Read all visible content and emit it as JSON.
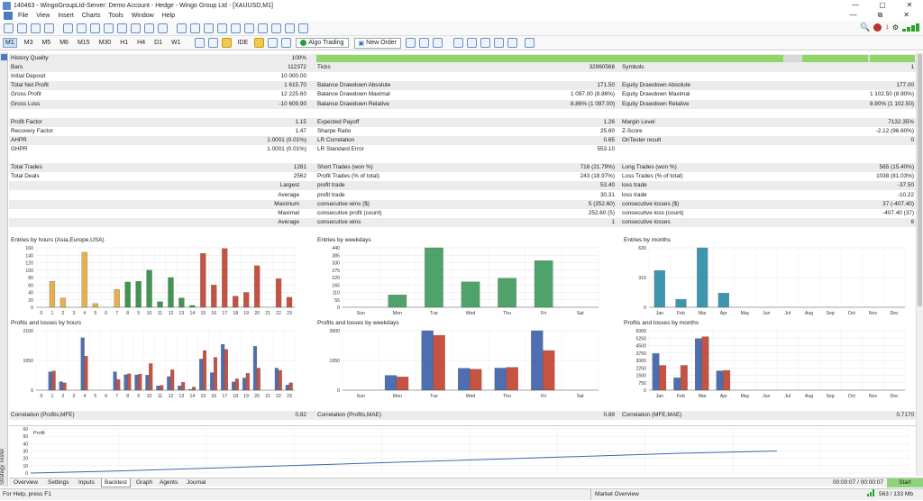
{
  "window": {
    "title": "140463 - WingoGroupLtd-Server: Demo Account - Hedge - Wingo Group Ltd - [XAUUSD,M1]",
    "controls": [
      "—",
      "▢",
      "✕"
    ]
  },
  "menu": {
    "items": [
      "File",
      "View",
      "Insert",
      "Charts",
      "Tools",
      "Window",
      "Help"
    ],
    "right": [
      "—",
      "⧉",
      "✕"
    ]
  },
  "toolbar": {
    "timeframes": [
      "M1",
      "M3",
      "M5",
      "M6",
      "M15",
      "M30",
      "H1",
      "H4",
      "D1",
      "W1"
    ],
    "ide": "IDE",
    "algo_trading": "Algo Trading",
    "new_order": "New Order",
    "signal_count": "1"
  },
  "sidebar": {
    "label": "Strategy Tester"
  },
  "stats": {
    "history_quality_label": "History Quality",
    "history_quality": "100%",
    "history_bar": [
      {
        "start": 0.0,
        "end": 0.78
      },
      {
        "start": 0.812,
        "end": 0.922
      },
      {
        "start": 0.924,
        "end": 1.0
      }
    ],
    "rows": [
      {
        "y": 0,
        "shade": true,
        "c": [
          [
            "Bars",
            "112372"
          ],
          [
            "Ticks",
            "32960568"
          ],
          [
            "Symbols",
            "1"
          ]
        ]
      },
      {
        "y": 1,
        "shade": false,
        "c": [
          [
            "Initial Deposit",
            "10 000.00"
          ],
          [
            "",
            ""
          ],
          [
            "",
            ""
          ]
        ]
      },
      {
        "y": 2,
        "shade": true,
        "c": [
          [
            "Total Net Profit",
            "1 615.70"
          ],
          [
            "Balance Drawdown Absolute",
            "171.50"
          ],
          [
            "Equity Drawdown Absolute",
            "177.00"
          ]
        ]
      },
      {
        "y": 3,
        "shade": false,
        "c": [
          [
            "Gross Profit",
            "12 225.60"
          ],
          [
            "Balance Drawdown Maximal",
            "1 097.00 (8.86%)"
          ],
          [
            "Equity Drawdown Maximal",
            "1 102.50 (8.90%)"
          ]
        ]
      },
      {
        "y": 4,
        "shade": true,
        "c": [
          [
            "Gross Loss",
            "-10 609.90"
          ],
          [
            "Balance Drawdown Relative",
            "8.86% (1 097.00)"
          ],
          [
            "Equity Drawdown Relative",
            "8.90% (1 102.50)"
          ]
        ]
      },
      {
        "y": 6,
        "shade": true,
        "c": [
          [
            "Profit Factor",
            "1.15"
          ],
          [
            "Expected Payoff",
            "1.26"
          ],
          [
            "Margin Level",
            "7132.35%"
          ]
        ]
      },
      {
        "y": 7,
        "shade": false,
        "c": [
          [
            "Recovery Factor",
            "1.47"
          ],
          [
            "Sharpe Ratio",
            "25.60"
          ],
          [
            "Z-Score",
            "-2.12 (96.60%)"
          ]
        ]
      },
      {
        "y": 8,
        "shade": true,
        "c": [
          [
            "AHPR",
            "1.0001 (0.01%)"
          ],
          [
            "LR Correlation",
            "0.65"
          ],
          [
            "OnTester result",
            "0"
          ]
        ]
      },
      {
        "y": 9,
        "shade": false,
        "c": [
          [
            "GHPR",
            "1.0001 (0.01%)"
          ],
          [
            "LR Standard Error",
            "553.10"
          ],
          [
            "",
            ""
          ]
        ]
      },
      {
        "y": 11,
        "shade": true,
        "c": [
          [
            "Total Trades",
            "1281"
          ],
          [
            "Short Trades (won %)",
            "716 (21.79%)"
          ],
          [
            "Long Trades (won %)",
            "565 (15.40%)"
          ]
        ]
      },
      {
        "y": 12,
        "shade": false,
        "c": [
          [
            "Total Deals",
            "2562"
          ],
          [
            "Profit Trades (% of total)",
            "243 (18.97%)"
          ],
          [
            "Loss Trades (% of total)",
            "1038 (81.03%)"
          ]
        ]
      }
    ],
    "sub_rows": [
      {
        "y": 13,
        "shade": true,
        "label": "Largest",
        "c": [
          [
            "profit trade",
            "53.40"
          ],
          [
            "loss trade",
            "-37.50"
          ]
        ]
      },
      {
        "y": 14,
        "shade": false,
        "label": "Average",
        "c": [
          [
            "profit trade",
            "30.31"
          ],
          [
            "loss trade",
            "-10.22"
          ]
        ]
      },
      {
        "y": 15,
        "shade": true,
        "label": "Maximum",
        "c": [
          [
            "consecutive wins ($)",
            "5 (252.60)"
          ],
          [
            "consecutive losses ($)",
            "37 (-407.40)"
          ]
        ]
      },
      {
        "y": 16,
        "shade": false,
        "label": "Maximal",
        "c": [
          [
            "consecutive profit (count)",
            "252.60 (5)"
          ],
          [
            "consecutive loss (count)",
            "-407.40 (37)"
          ]
        ]
      },
      {
        "y": 17,
        "shade": true,
        "label": "Average",
        "c": [
          [
            "consecutive wins",
            "1"
          ],
          [
            "consecutive losses",
            "6"
          ]
        ]
      }
    ],
    "sub_first_values": [
      "",
      "",
      "",
      "",
      ""
    ],
    "correlations": [
      [
        "Correlation (Profits,MFE)",
        "0.82"
      ],
      [
        "Correlation (Profits,MAE)",
        "0.89"
      ],
      [
        "Correlation (MFE,MAE)",
        "0.7170"
      ]
    ]
  },
  "chart_data": [
    {
      "type": "bar",
      "title": "Entries by hours (Asia,Europe,USA)",
      "ylim": [
        0,
        160
      ],
      "yticks": [
        "0",
        "20",
        "40",
        "60",
        "80",
        "100",
        "120",
        "140",
        "160"
      ],
      "categories": [
        "0",
        "1",
        "2",
        "3",
        "4",
        "5",
        "6",
        "7",
        "8",
        "9",
        "10",
        "11",
        "12",
        "13",
        "14",
        "15",
        "16",
        "17",
        "18",
        "19",
        "20",
        "21",
        "22",
        "23"
      ],
      "series": [
        {
          "values": [
            0,
            70,
            25,
            0,
            148,
            10,
            0,
            48,
            68,
            70,
            100,
            15,
            80,
            25,
            5,
            145,
            60,
            158,
            30,
            40,
            112,
            0,
            77,
            27
          ]
        }
      ],
      "colors": [
        "#e0a93a",
        "#e0a93a",
        "#e0a93a",
        "#e0a93a",
        "#e0a93a",
        "#e0a93a",
        "#e0a93a",
        "#e0a93a",
        "#2c8a3c",
        "#2c8a3c",
        "#2c8a3c",
        "#2c8a3c",
        "#2c8a3c",
        "#2c8a3c",
        "#2c8a3c",
        "#c0402e",
        "#c0402e",
        "#c0402e",
        "#c0402e",
        "#c0402e",
        "#c0402e",
        "#c0402e",
        "#c0402e",
        "#c0402e"
      ]
    },
    {
      "type": "bar",
      "title": "Entries by weekdays",
      "ylim": [
        0,
        440
      ],
      "yticks": [
        "0",
        "55",
        "110",
        "165",
        "220",
        "275",
        "330",
        "385",
        "440"
      ],
      "categories": [
        "Sun",
        "Mon",
        "Tue",
        "Wed",
        "Thu",
        "Fri",
        "Sat"
      ],
      "series": [
        {
          "values": [
            0,
            92,
            440,
            188,
            215,
            345,
            0
          ]
        }
      ],
      "color": "#3d9a5a"
    },
    {
      "type": "bar",
      "title": "Entries by months",
      "ylim": [
        0,
        630
      ],
      "yticks": [
        "0",
        "315",
        "630"
      ],
      "categories": [
        "Jan",
        "Feb",
        "Mar",
        "Apr",
        "May",
        "Jun",
        "Jul",
        "Aug",
        "Sep",
        "Oct",
        "Nov",
        "Dec"
      ],
      "series": [
        {
          "values": [
            390,
            85,
            630,
            150,
            0,
            0,
            0,
            0,
            0,
            0,
            0,
            0
          ]
        }
      ],
      "color": "#2a8aa8"
    },
    {
      "type": "bar",
      "title": "Profits and losses by hours",
      "ylim": [
        0,
        2100
      ],
      "yticks": [
        "0",
        "1050",
        "2100"
      ],
      "categories": [
        "0",
        "1",
        "2",
        "3",
        "4",
        "5",
        "6",
        "7",
        "8",
        "9",
        "10",
        "11",
        "12",
        "13",
        "14",
        "15",
        "16",
        "17",
        "18",
        "19",
        "20",
        "21",
        "22",
        "23"
      ],
      "series": [
        {
          "name": "",
          "values": [
            0,
            650,
            300,
            0,
            1850,
            0,
            0,
            650,
            550,
            540,
            530,
            150,
            480,
            150,
            30,
            1100,
            620,
            1620,
            290,
            430,
            1550,
            0,
            780,
            180
          ]
        },
        {
          "name": "",
          "values": [
            0,
            680,
            260,
            0,
            1200,
            0,
            0,
            380,
            580,
            570,
            940,
            170,
            720,
            280,
            110,
            1400,
            1160,
            1440,
            400,
            600,
            780,
            0,
            700,
            260
          ]
        }
      ],
      "colors": [
        "#3a5fa8",
        "#c0402e"
      ]
    },
    {
      "type": "bar",
      "title": "Profits and losses by weekdays",
      "ylim": [
        0,
        3900
      ],
      "yticks": [
        "0",
        "1950",
        "3900"
      ],
      "categories": [
        "Sun",
        "Mon",
        "Tue",
        "Wed",
        "Thu",
        "Fri",
        "Sat"
      ],
      "series": [
        {
          "name": "",
          "values": [
            0,
            970,
            3900,
            1440,
            1450,
            3900,
            0
          ]
        },
        {
          "name": "",
          "values": [
            0,
            870,
            3600,
            1380,
            1500,
            2600,
            0
          ]
        }
      ],
      "colors": [
        "#3a5fa8",
        "#c0402e"
      ]
    },
    {
      "type": "bar",
      "title": "Profits and losses by months",
      "ylim": [
        0,
        6000
      ],
      "yticks": [
        "0",
        "750",
        "1500",
        "2250",
        "3000",
        "3750",
        "4500",
        "5250",
        "6000"
      ],
      "categories": [
        "Jan",
        "Feb",
        "Mar",
        "Apr",
        "May",
        "Jun",
        "Jul",
        "Aug",
        "Sep",
        "Oct",
        "Nov",
        "Dec"
      ],
      "series": [
        {
          "name": "",
          "values": [
            3700,
            1250,
            5200,
            1950,
            0,
            0,
            0,
            0,
            0,
            0,
            0,
            0
          ]
        },
        {
          "name": "",
          "values": [
            2500,
            2500,
            5400,
            2000,
            0,
            0,
            0,
            0,
            0,
            0,
            0,
            0
          ]
        }
      ],
      "colors": [
        "#3a5fa8",
        "#c0402e"
      ]
    },
    {
      "type": "line",
      "title": "Profit",
      "ylim": [
        0,
        60
      ],
      "yticks": [
        "0",
        "10",
        "20",
        "30",
        "40",
        "50",
        "60"
      ],
      "series": [
        {
          "values": [
            0,
            3,
            7,
            11,
            15,
            19,
            23,
            27,
            30
          ]
        }
      ],
      "color": "#3a6aa8"
    }
  ],
  "tabs": [
    "Overview",
    "Settings",
    "Inputs",
    "Backtest",
    "Graph",
    "Agents",
    "Journal"
  ],
  "timer": "00:00:07 / 00:00:07",
  "start_label": "Start",
  "status": {
    "help": "For Help, press F1",
    "market": "Market Overview",
    "memory": "563 / 133 Mb"
  }
}
